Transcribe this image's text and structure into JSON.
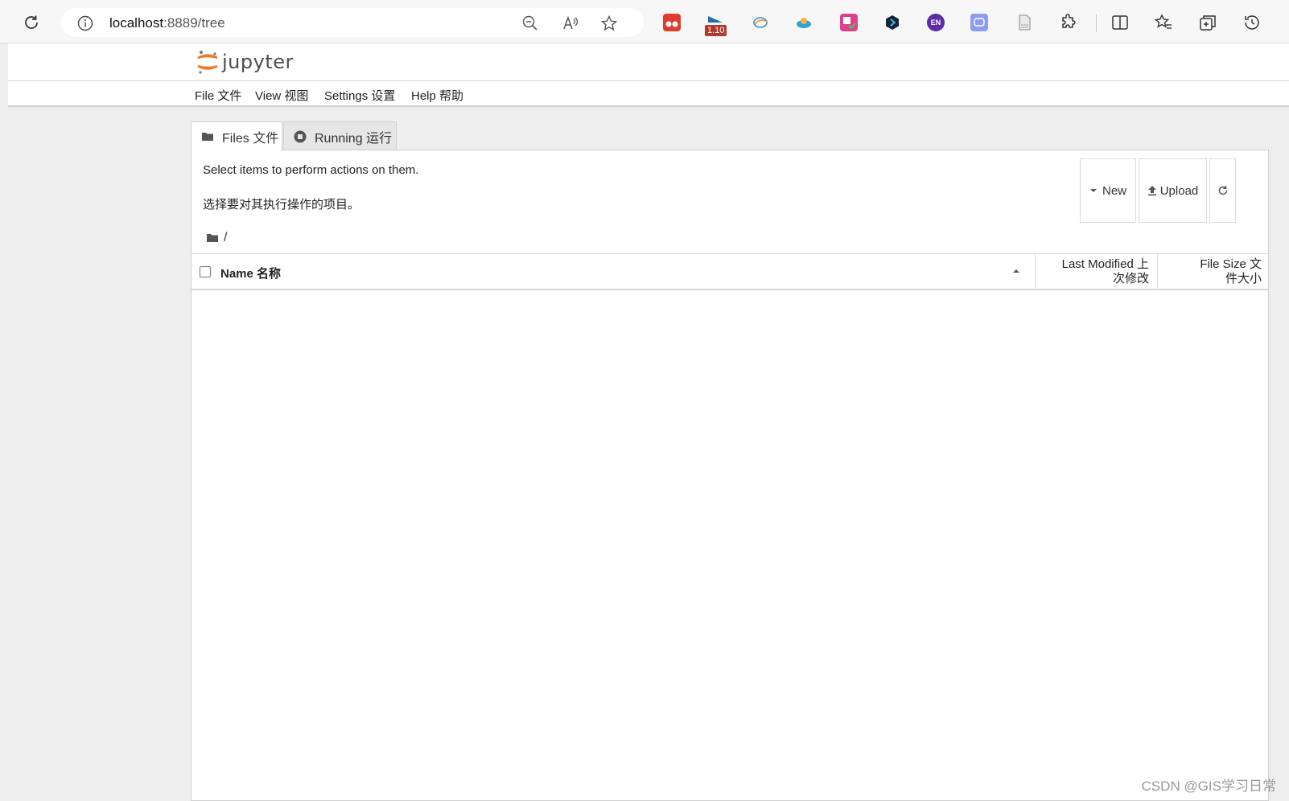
{
  "browser": {
    "url_host": "localhost",
    "url_rest": ":8889/tree",
    "extension_badge": "1.10",
    "extension_en_label": "EN"
  },
  "header": {
    "logo_text": "jupyter"
  },
  "menu": {
    "items": [
      {
        "label": "File 文件"
      },
      {
        "label": "View 视图"
      },
      {
        "label": "Settings 设置"
      },
      {
        "label": "Help 帮助"
      }
    ]
  },
  "tabs": [
    {
      "label": "Files 文件"
    },
    {
      "label": "Running 运行"
    }
  ],
  "panel": {
    "info_en": "Select items to perform actions on them.",
    "info_zh": "选择要对其执行操作的项目。",
    "new_label": "New",
    "upload_label": "Upload",
    "breadcrumb": "/"
  },
  "list": {
    "col_name": "Name 名称",
    "col_modified_1": "Last Modified 上",
    "col_modified_2": "次修改",
    "col_size_1": "File Size 文",
    "col_size_2": "件大小"
  },
  "watermark": "CSDN @GIS学习日常",
  "colors": {
    "jupyter_orange": "#f37726",
    "page_bg": "#eeeeee"
  }
}
